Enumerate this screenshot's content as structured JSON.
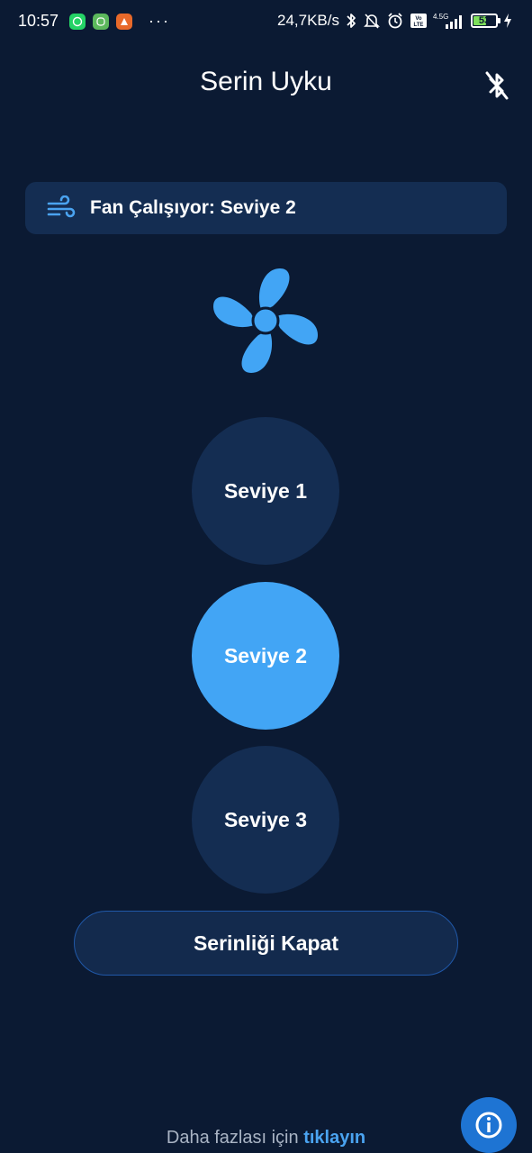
{
  "status_bar": {
    "time": "10:57",
    "network_speed": "24,7KB/s",
    "network_type": "4.5G",
    "volte_label": "Vo LTE",
    "battery_level": "53",
    "icons": [
      "whatsapp-icon",
      "app-icon-green",
      "app-icon-orange",
      "more-dots",
      "bluetooth-icon",
      "mute-icon",
      "alarm-icon",
      "volte-icon",
      "signal-icon",
      "battery-icon",
      "charging-icon"
    ]
  },
  "appbar": {
    "title": "Serin Uyku",
    "bluetooth_icon": "bluetooth-disabled-icon"
  },
  "status_card": {
    "icon": "wind-icon",
    "text": "Fan Çalışıyor: Seviye 2"
  },
  "fan_icon": "fan-icon",
  "levels": [
    {
      "label": "Seviye 1",
      "active": false
    },
    {
      "label": "Seviye 2",
      "active": true
    },
    {
      "label": "Seviye 3",
      "active": false
    }
  ],
  "off_button": {
    "label": "Serinliği Kapat"
  },
  "footer": {
    "text": "Daha fazlası için",
    "link": "tıklayın"
  },
  "info_fab": {
    "icon": "info-icon"
  },
  "colors": {
    "background": "#0b1a33",
    "card": "#142d52",
    "accent": "#42a5f5",
    "link": "#4aa3f0",
    "fab": "#1e74d3"
  }
}
